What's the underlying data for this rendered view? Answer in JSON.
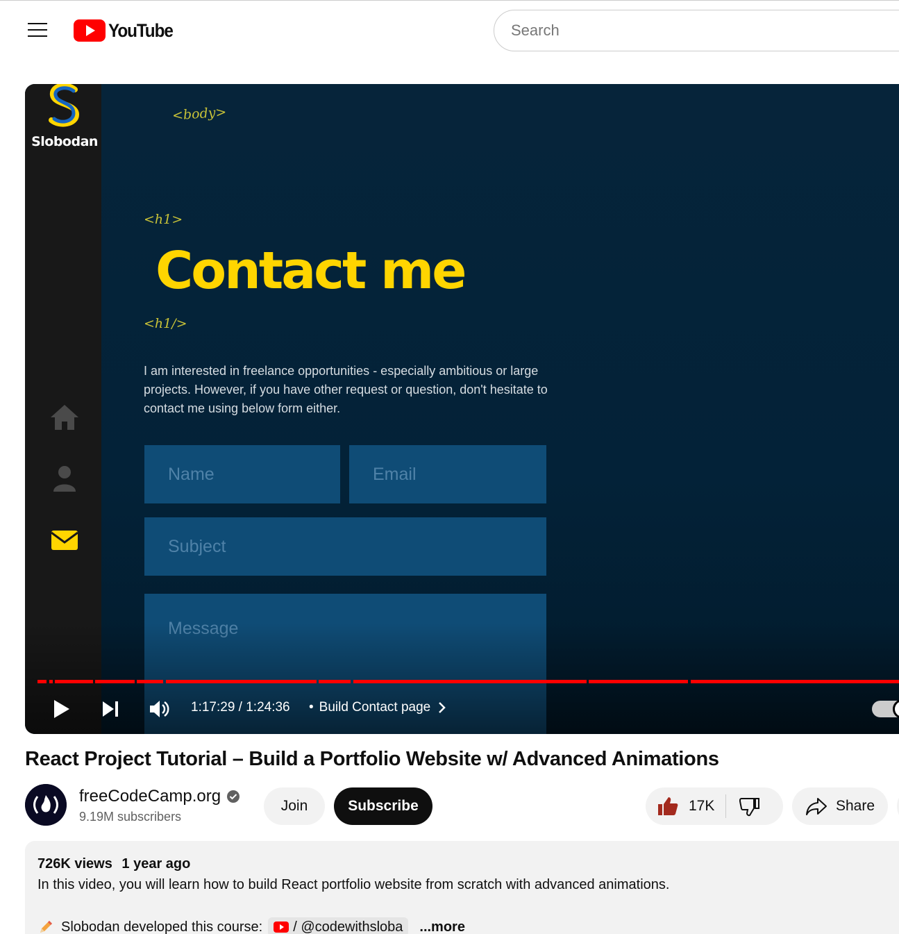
{
  "header": {
    "logo_text": "YouTube",
    "search_placeholder": "Search"
  },
  "video": {
    "sidebar_name": "Slobodan",
    "tag_body": "<body>",
    "tag_h1_open": "<h1>",
    "tag_h1_close": "<h1/>",
    "heading": "Contact me",
    "paragraph": "I am interested in freelance opportunities - especially ambitious or large projects. However, if you have other request or question, don't hesitate to contact me using below form either.",
    "fields": {
      "name": "Name",
      "email": "Email",
      "subject": "Subject",
      "message": "Message"
    },
    "time": "1:17:29 / 1:24:36",
    "chapter_separator": "•",
    "chapter": "Build Contact page",
    "progress": 0.915
  },
  "info": {
    "title": "React Project Tutorial – Build a Portfolio Website w/ Advanced Animations",
    "channel": "freeCodeCamp.org",
    "subscribers": "9.19M subscribers",
    "join_label": "Join",
    "subscribe_label": "Subscribe",
    "likes": "17K",
    "share_label": "Share"
  },
  "description": {
    "views": "726K views",
    "age": "1 year ago",
    "text": "In this video, you will learn how to build React portfolio website from scratch with advanced animations.",
    "credit_label": "Slobodan developed this course:",
    "credit_link": "/ @codewithsloba",
    "more_label": "...more"
  },
  "colors": {
    "brand_red": "#ff0000",
    "video_heading": "#ffd500",
    "like_icon": "#a32a1e"
  }
}
